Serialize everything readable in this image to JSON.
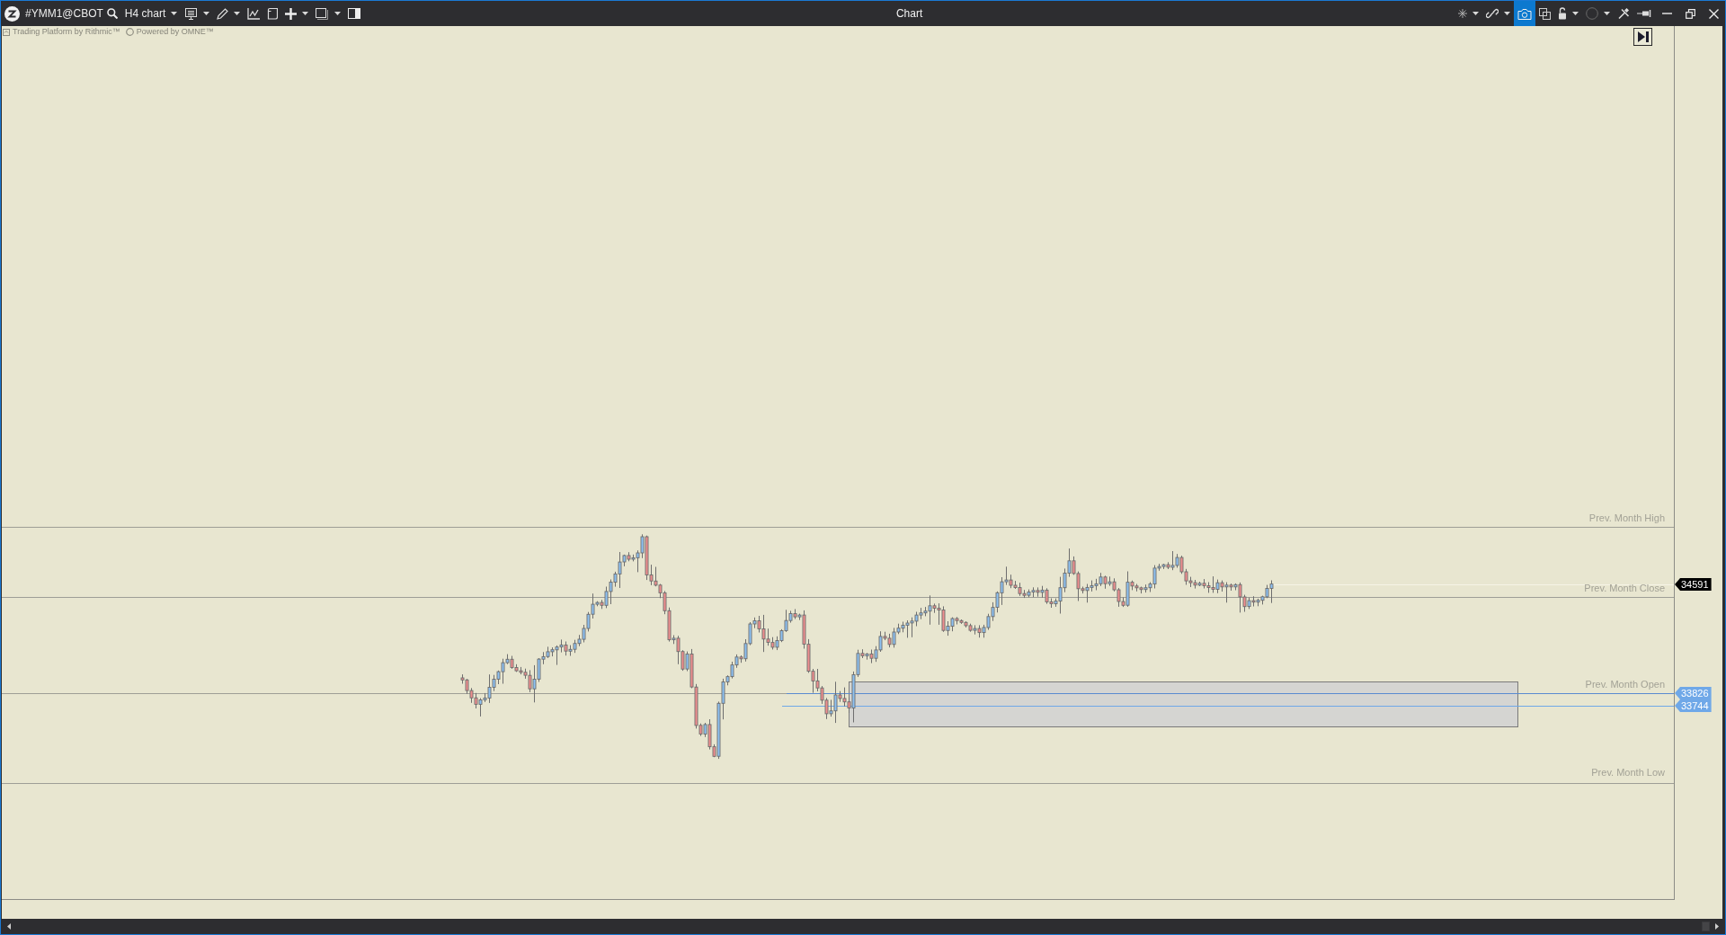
{
  "window": {
    "title": "Chart"
  },
  "toolbar": {
    "symbol": "#YMM1@CBOT",
    "timeframe": "H4 chart",
    "left_tools": [
      {
        "kind": "display",
        "dropdown": true
      },
      {
        "kind": "pencil",
        "dropdown": true
      },
      {
        "kind": "indicator",
        "dropdown": false
      },
      {
        "kind": "template",
        "dropdown": false
      },
      {
        "kind": "crosshair",
        "dropdown": true
      },
      {
        "kind": "window",
        "dropdown": true
      },
      {
        "kind": "panel",
        "dropdown": false
      }
    ],
    "right_tools": [
      {
        "kind": "cursor",
        "dropdown": true,
        "on": false
      },
      {
        "kind": "link",
        "dropdown": true,
        "on": false
      },
      {
        "kind": "camera",
        "dropdown": false,
        "on": true
      },
      {
        "kind": "windows",
        "dropdown": false,
        "on": false
      },
      {
        "kind": "lock",
        "dropdown": true,
        "on": false
      },
      {
        "kind": "circle",
        "dropdown": true,
        "on": false
      },
      {
        "kind": "tools",
        "dropdown": false,
        "on": false
      },
      {
        "kind": "pin",
        "dropdown": false,
        "on": false
      }
    ]
  },
  "branding": {
    "platform": "Trading Platform by Rithmic™",
    "powered_by": "Powered by OMNE™"
  },
  "chart": {
    "levels": [
      {
        "label": "Prev. Month High"
      },
      {
        "label": "Prev. Month Close"
      },
      {
        "label": "Prev. Month Open"
      },
      {
        "label": "Prev. Month Low"
      }
    ],
    "price_tags": [
      {
        "text": "34591",
        "color": "#000000"
      },
      {
        "text": "33826",
        "color": "#6fa8e8"
      },
      {
        "text": "33744",
        "color": "#6fa8e8"
      }
    ]
  }
}
